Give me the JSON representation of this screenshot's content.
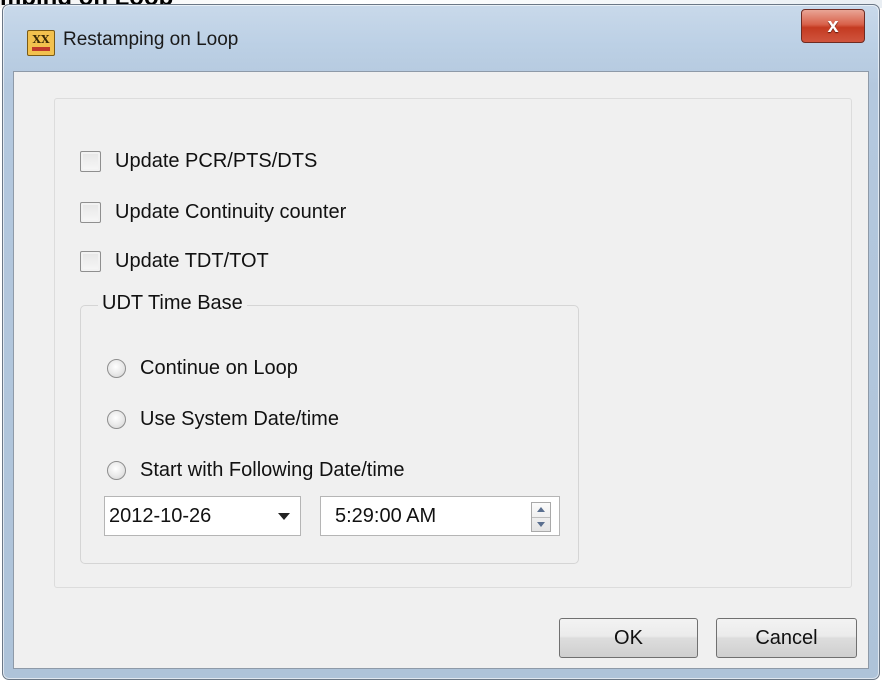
{
  "background": {
    "caption": "mping on Loop"
  },
  "window": {
    "title": "Restamping on Loop",
    "app_icon_text": "XX",
    "close_label": "x"
  },
  "options": {
    "update_pcr": "Update PCR/PTS/DTS",
    "update_cc": "Update Continuity counter",
    "update_tdt": "Update TDT/TOT"
  },
  "time_base": {
    "legend": "UDT Time Base",
    "continue_on_loop": "Continue on Loop",
    "use_system_datetime": "Use System Date/time",
    "start_with_following": "Start with Following Date/time",
    "date_value": "2012-10-26",
    "time_value": "5:29:00 AM"
  },
  "buttons": {
    "ok": "OK",
    "cancel": "Cancel"
  },
  "colors": {
    "titlebar": "#b4c8de",
    "close_button": "#c43a21",
    "client_bg": "#f0f0f0"
  }
}
